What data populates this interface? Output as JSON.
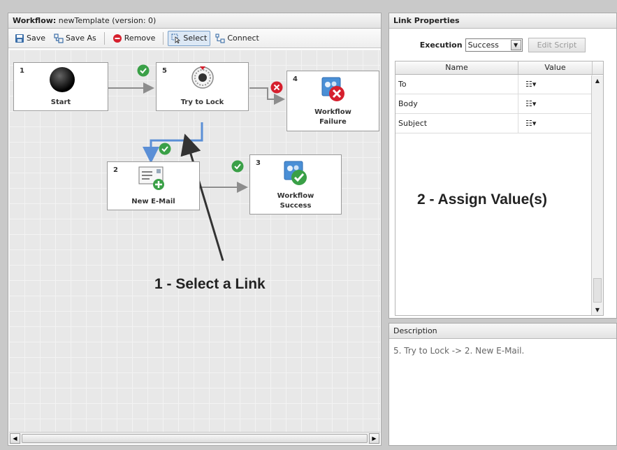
{
  "workflow": {
    "title_bold": "Workflow:",
    "title_rest": " newTemplate (version: 0)",
    "toolbar": {
      "save_label": "Save",
      "save_as_label": "Save As",
      "remove_label": "Remove",
      "select_label": "Select",
      "connect_label": "Connect"
    },
    "nodes": [
      {
        "num": "1",
        "label": "Start"
      },
      {
        "num": "5",
        "label": "Try to Lock"
      },
      {
        "num": "4",
        "label_line1": "Workflow",
        "label_line2": "Failure"
      },
      {
        "num": "2",
        "label": "New E-Mail"
      },
      {
        "num": "3",
        "label_line1": "Workflow",
        "label_line2": "Success"
      }
    ],
    "annotation": "1 - Select a Link",
    "colors": {
      "selected_link": "#5b8fd6",
      "success": "#3aa047",
      "failure": "#d6202e"
    }
  },
  "link_properties": {
    "title": "Link Properties",
    "execution_label": "Execution",
    "execution_value": "Success",
    "edit_script_label": "Edit Script",
    "columns": [
      "Name",
      "Value"
    ],
    "rows": [
      {
        "name": "To"
      },
      {
        "name": "Body"
      },
      {
        "name": "Subject"
      }
    ],
    "annotation": "2 - Assign Value(s)"
  },
  "description": {
    "title": "Description",
    "text": "5. Try to Lock -> 2. New E-Mail."
  }
}
